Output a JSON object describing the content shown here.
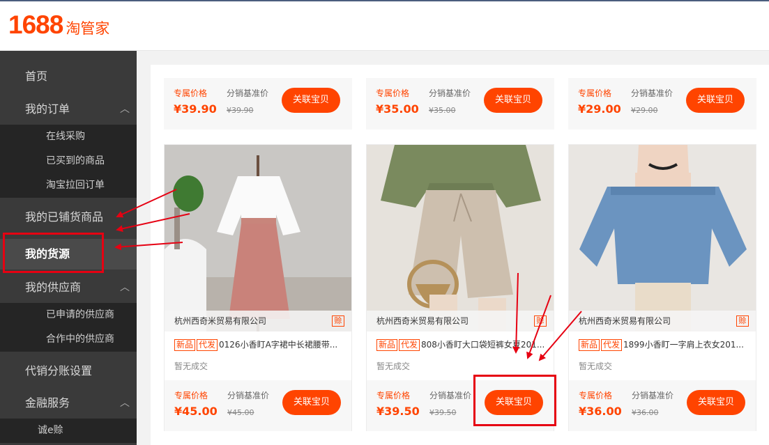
{
  "header": {
    "logo_number": "1688",
    "logo_text": "淘管家"
  },
  "sidebar": {
    "home": "首页",
    "orders": "我的订单",
    "orders_sub": [
      "在线采购",
      "已买到的商品",
      "淘宝拉回订单"
    ],
    "distributed": "我的已铺货商品",
    "sources": "我的货源",
    "suppliers": "我的供应商",
    "suppliers_sub": [
      "已申请的供应商",
      "合作中的供应商"
    ],
    "split_settings": "代销分账设置",
    "finance": "金融服务",
    "finance_sub": [
      "诚e赊"
    ]
  },
  "labels": {
    "exclusive_price": "专属价格",
    "base_price": "分销基准价",
    "link_button": "关联宝贝",
    "tag_new": "新品",
    "tag_dropship": "代发",
    "insurance": "赊",
    "no_deals": "暂无成交"
  },
  "top_prices": [
    {
      "price": "¥39.90",
      "base": "¥39.90"
    },
    {
      "price": "¥35.00",
      "base": "¥35.00"
    },
    {
      "price": "¥29.00",
      "base": "¥29.00"
    }
  ],
  "products": [
    {
      "shop": "杭州西奇米贸易有限公司",
      "title": "0126小香盯A字裙中长裙腰带...",
      "price": "¥45.00",
      "base": "¥45.00"
    },
    {
      "shop": "杭州西奇米贸易有限公司",
      "title": "808小香盯大口袋短裤女夏201...",
      "price": "¥39.50",
      "base": "¥39.50"
    },
    {
      "shop": "杭州西奇米贸易有限公司",
      "title": "1899小香盯一字肩上衣女201...",
      "price": "¥36.00",
      "base": "¥36.00"
    }
  ],
  "colors": {
    "brand": "#ff4400",
    "annotation": "#e60012",
    "sidebar": "#3a3a3a"
  }
}
